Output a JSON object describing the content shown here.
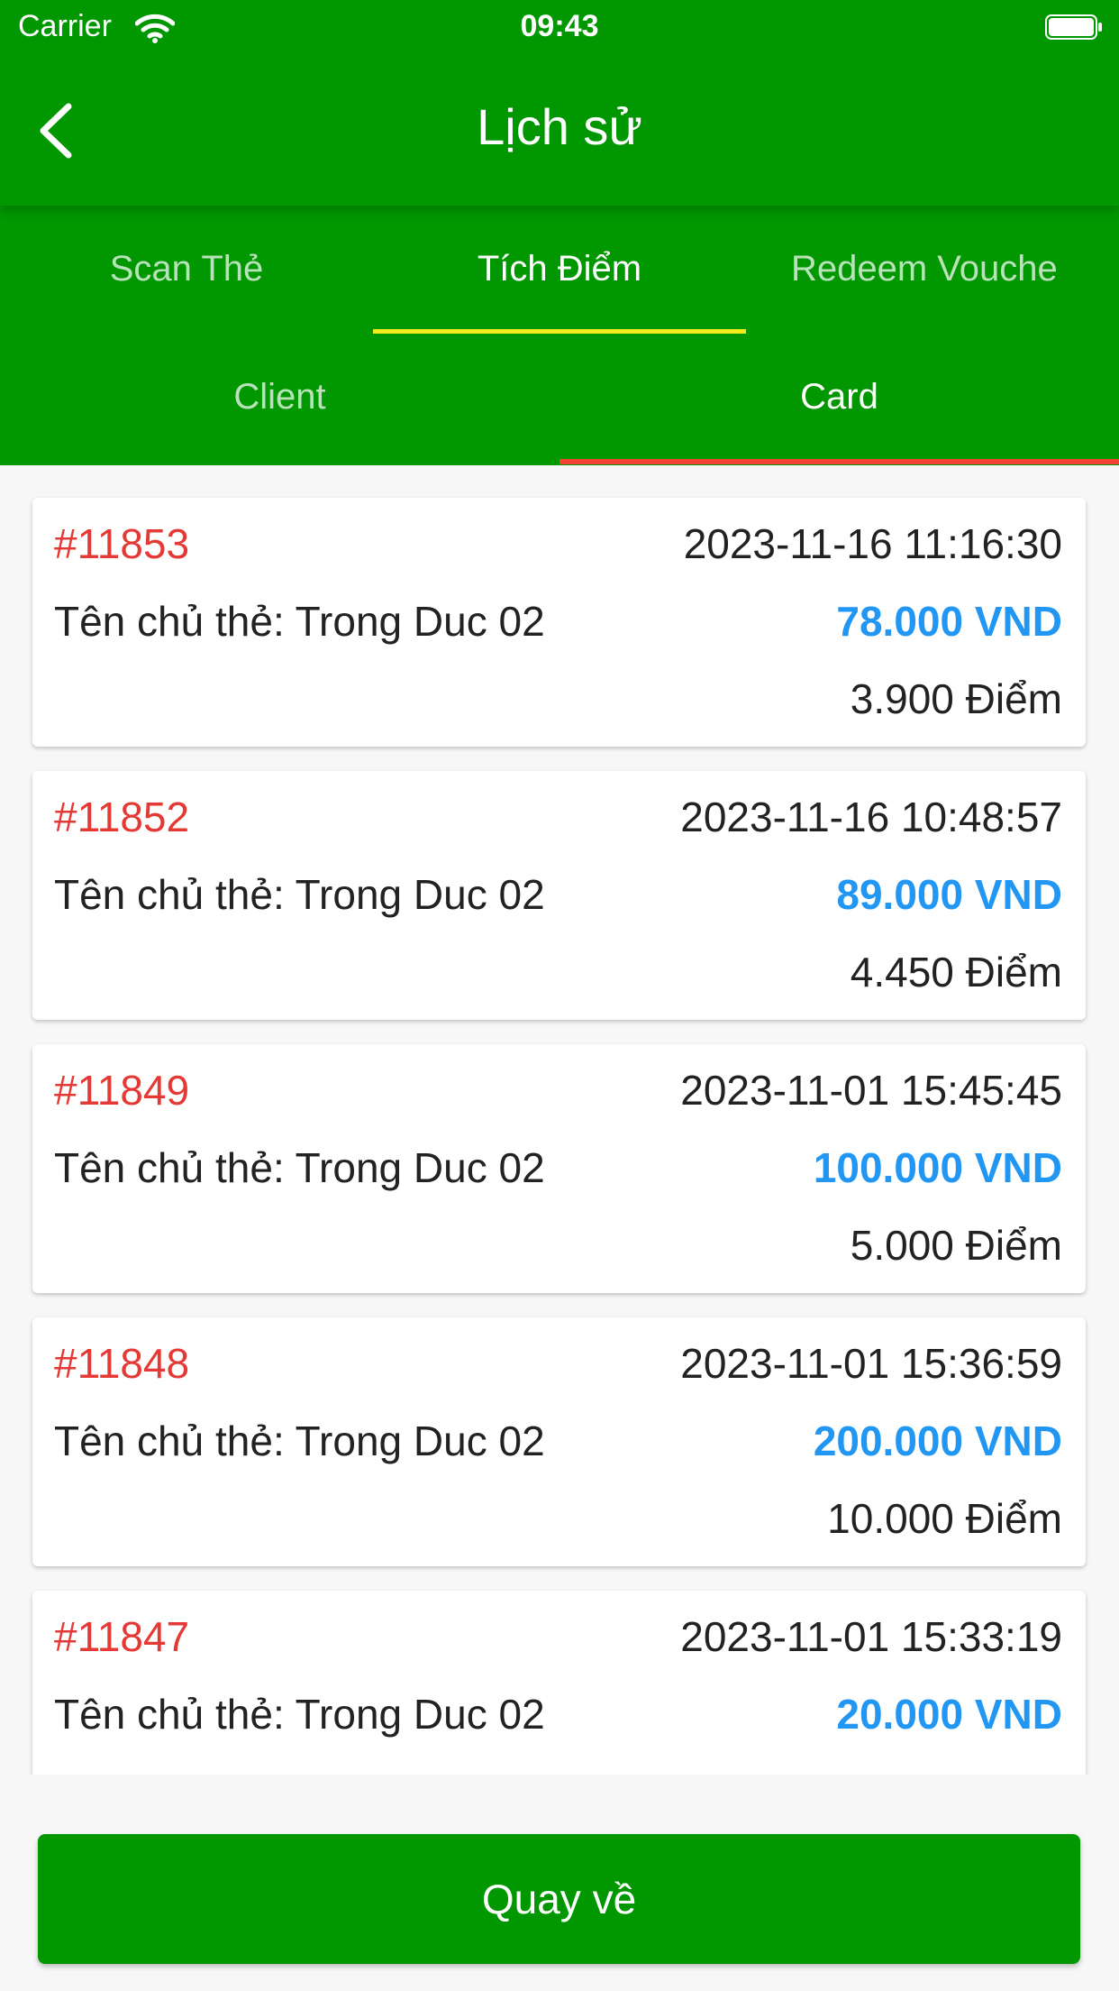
{
  "status_bar": {
    "carrier": "Carrier",
    "time": "09:43"
  },
  "header": {
    "title": "Lịch sử",
    "back_icon": "chevron-left-icon"
  },
  "tabs": [
    {
      "label": "Scan Thẻ",
      "active": false
    },
    {
      "label": "Tích Điểm",
      "active": true
    },
    {
      "label": "Redeem Vouche",
      "active": false
    }
  ],
  "sub_tabs": [
    {
      "label": "Client",
      "active": false
    },
    {
      "label": "Card",
      "active": true
    }
  ],
  "transactions": [
    {
      "id": "#11853",
      "datetime": "2023-11-16 11:16:30",
      "holder": "Tên chủ thẻ: Trong Duc 02",
      "amount": "78.000 VND",
      "points": "3.900 Điểm"
    },
    {
      "id": "#11852",
      "datetime": "2023-11-16 10:48:57",
      "holder": "Tên chủ thẻ: Trong Duc 02",
      "amount": "89.000 VND",
      "points": "4.450 Điểm"
    },
    {
      "id": "#11849",
      "datetime": "2023-11-01 15:45:45",
      "holder": "Tên chủ thẻ: Trong Duc 02",
      "amount": "100.000 VND",
      "points": "5.000 Điểm"
    },
    {
      "id": "#11848",
      "datetime": "2023-11-01 15:36:59",
      "holder": "Tên chủ thẻ: Trong Duc 02",
      "amount": "200.000 VND",
      "points": "10.000 Điểm"
    },
    {
      "id": "#11847",
      "datetime": "2023-11-01 15:33:19",
      "holder": "Tên chủ thẻ: Trong Duc 02",
      "amount": "20.000 VND",
      "points": ""
    }
  ],
  "footer": {
    "button_label": "Quay về"
  },
  "colors": {
    "primary_green": "#019700",
    "tab_indicator": "#f2ea1b",
    "subtab_indicator": "#f44336",
    "id_red": "#e53935",
    "amount_blue": "#2196f3"
  }
}
